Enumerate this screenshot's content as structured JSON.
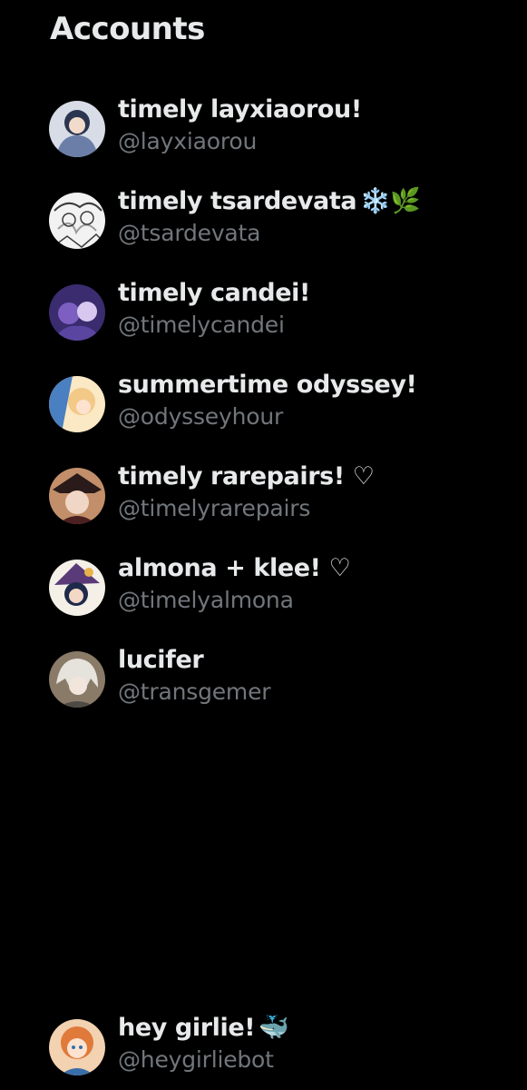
{
  "header": {
    "title": "Accounts"
  },
  "accounts": [
    {
      "display_name": "timely layxiaorou!",
      "handle": "@layxiaorou",
      "emoji": "",
      "avatar_colors": [
        "#2b3550",
        "#d8dce6",
        "#6b7ea8"
      ]
    },
    {
      "display_name": "timely tsardevata",
      "handle": "@tsardevata",
      "emoji": "❄️🌿",
      "avatar_colors": [
        "#f2f2f2",
        "#9a9a9a",
        "#3c3c3c"
      ]
    },
    {
      "display_name": "timely candei!",
      "handle": "@timelycandei",
      "emoji": "",
      "avatar_colors": [
        "#3a2c6e",
        "#7d5fc2",
        "#d8c8f0"
      ]
    },
    {
      "display_name": "summertime odyssey!",
      "handle": "@odysseyhour",
      "emoji": "",
      "avatar_colors": [
        "#f3c988",
        "#4a7fc1",
        "#fbe8c4"
      ]
    },
    {
      "display_name": "timely rarepairs! ♡",
      "handle": "@timelyrarepairs",
      "emoji": "",
      "avatar_colors": [
        "#4a2020",
        "#c28f6a",
        "#2a1a1a"
      ]
    },
    {
      "display_name": "almona + klee! ♡",
      "handle": "@timelyalmona",
      "emoji": "",
      "avatar_colors": [
        "#1e2a4a",
        "#e9b24a",
        "#5a3a78"
      ]
    },
    {
      "display_name": "lucifer",
      "handle": "@transgemer",
      "emoji": "",
      "avatar_colors": [
        "#8a7a68",
        "#e6e2dc",
        "#4e4a44"
      ]
    },
    {
      "display_name": "hey girlie!",
      "handle": "@heygirliebot",
      "emoji": "🐳",
      "avatar_colors": [
        "#e07a3a",
        "#f2d2b0",
        "#3a6ea8"
      ]
    }
  ]
}
